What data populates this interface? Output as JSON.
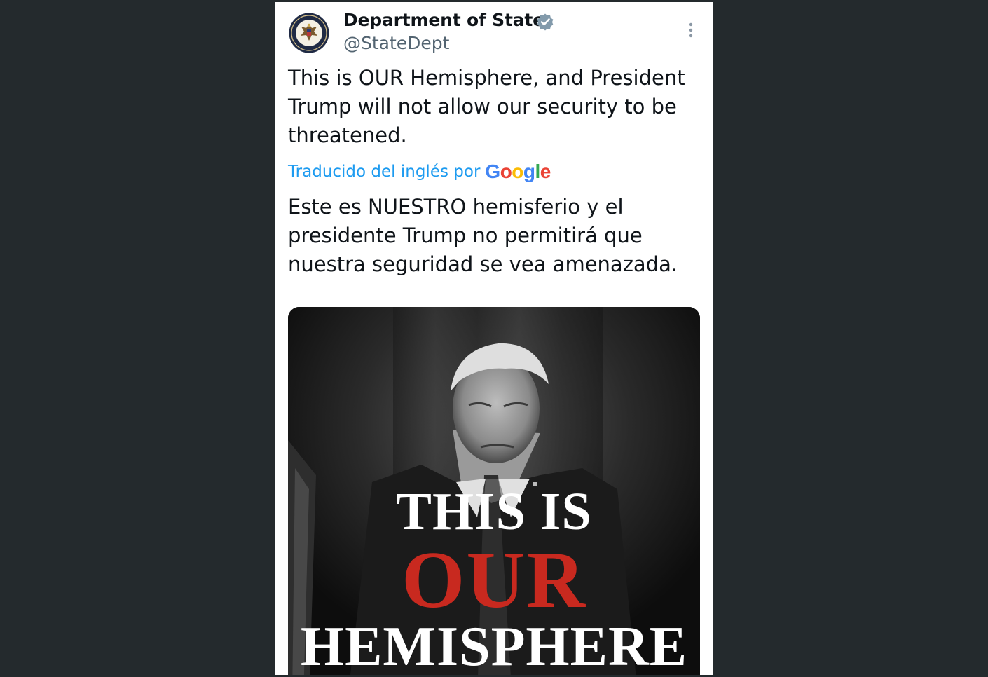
{
  "account": {
    "display_name": "Department of State",
    "handle": "@StateDept",
    "verified": true,
    "avatar_icon": "state-department-seal-icon"
  },
  "tweet": {
    "text": "This is OUR Hemisphere, and President Trump will not allow our security to be threatened.",
    "translation_label": "Traducido del inglés por",
    "translation_provider": "Google",
    "translated_text": "Este es NUESTRO hemisferio y el presidente Trump no permitirá que nuestra seguridad se vea amenazada."
  },
  "media": {
    "headline_line1": "THIS IS",
    "headline_line2": "OUR",
    "headline_line3": "HEMISPHERE",
    "accent_color": "#c8291f"
  },
  "colors": {
    "page_background": "#242a2d",
    "card_background": "#ffffff",
    "link_blue": "#1d9bf0",
    "verified_badge": "#829aab",
    "secondary_text": "#536471"
  }
}
